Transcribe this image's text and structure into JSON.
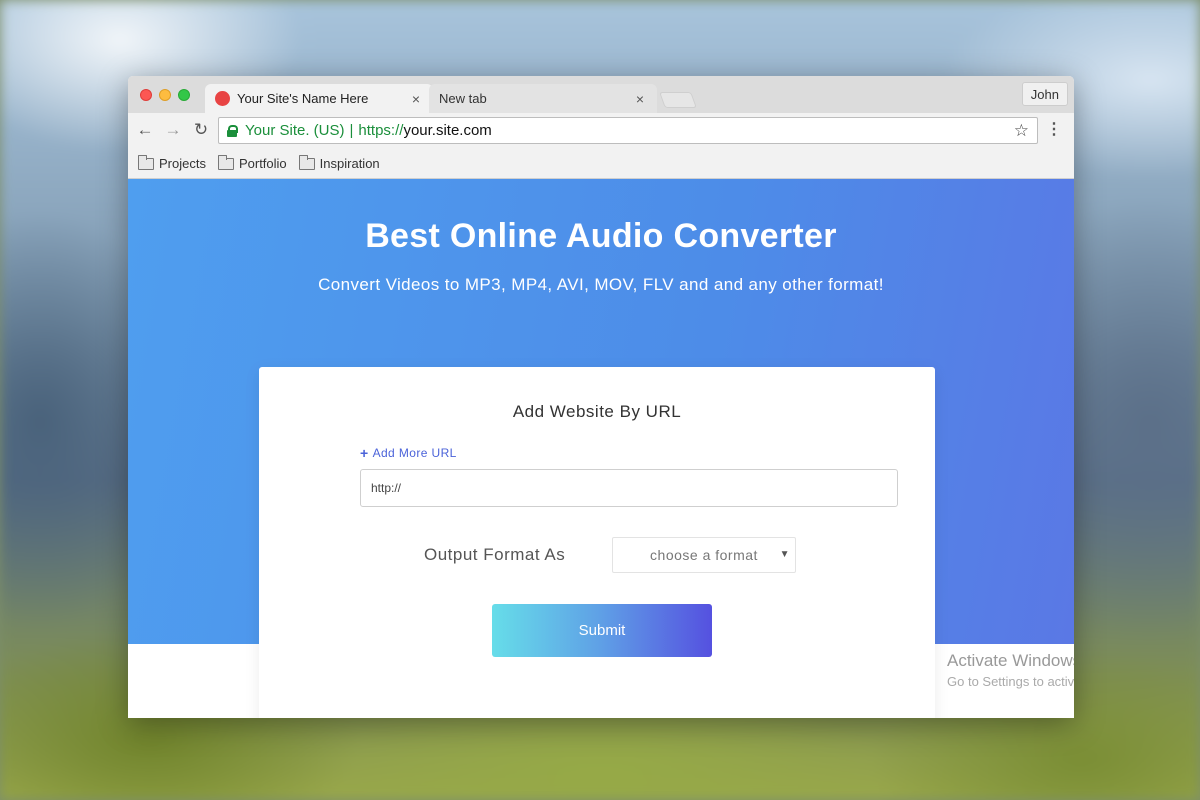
{
  "browser": {
    "tabs": [
      {
        "label": "Your Site's Name Here",
        "active": true
      },
      {
        "label": "New tab",
        "active": false
      }
    ],
    "tab_close_glyph": "×",
    "profile_name": "John",
    "address": {
      "site_label": "Your Site. (US)",
      "separator": "|",
      "scheme": "https://",
      "host": "your.site.com"
    },
    "bookmarks": [
      {
        "label": "Projects",
        "icon": "folder-icon"
      },
      {
        "label": "Portfolio",
        "icon": "folder-icon"
      },
      {
        "label": "Inspiration",
        "icon": "folder-icon"
      }
    ]
  },
  "hero": {
    "title": "Best Online Audio Converter",
    "subtitle": "Convert Videos to MP3, MP4, AVI, MOV, FLV and and any other format!"
  },
  "form": {
    "title": "Add Website By URL",
    "add_more_label": "Add More URL",
    "url_value": "http://",
    "format_label": "Output Format As",
    "format_selected": "choose a format",
    "submit_label": "Submit"
  },
  "watermark": {
    "line1": "Activate Windows",
    "line2": "Go to Settings to activate Windows."
  },
  "colors": {
    "hero_start": "#4f9eef",
    "hero_end": "#5a78e5",
    "link": "#4b63d9",
    "secure_green": "#1b8f3b",
    "button_start": "#66dde9",
    "button_end": "#5551e0"
  }
}
